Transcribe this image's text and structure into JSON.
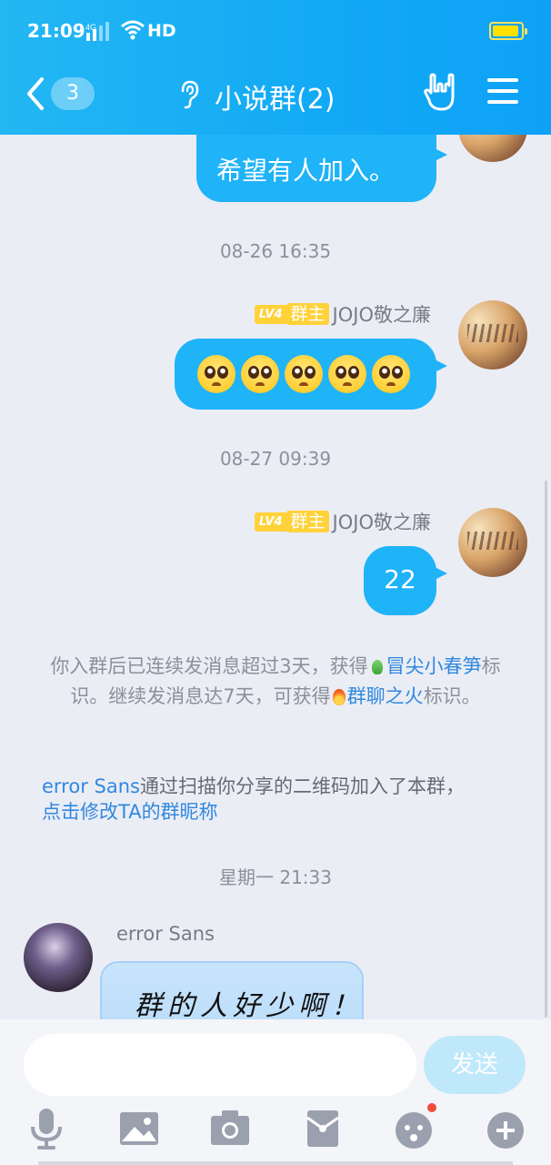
{
  "status_bar": {
    "time": "21:09",
    "network": "4G",
    "hd": "HD"
  },
  "header": {
    "back_count": "3",
    "title": "小说群(2)"
  },
  "messages": {
    "m1_text": "希望有人加入。",
    "ts1": "08-26 16:35",
    "m2_badge_level": "LV4",
    "m2_badge_role": "群主",
    "m2_sender": "JOJO敬之廉",
    "m2_emoji": "crying-pleading-emoji x5",
    "ts2": "08-27 09:39",
    "m3_badge_level": "LV4",
    "m3_badge_role": "群主",
    "m3_sender": "JOJO敬之廉",
    "m3_text": "22"
  },
  "notice": {
    "p1": "你入群后已连续发消息超过3天，获得",
    "link1": "冒尖小春笋",
    "p2": "标识。继续发消息达7天，可获得",
    "link2": "群聊之火",
    "p3": "标识。"
  },
  "join": {
    "user": "error Sans",
    "text": "通过扫描你分享的二维码加入了本群，",
    "link": "点击修改TA的群昵称"
  },
  "ts3": "星期一 21:33",
  "incoming": {
    "sender": "error Sans",
    "handwriting": "群的人好少啊！"
  },
  "composer": {
    "input_value": "",
    "send_label": "发送"
  },
  "toolbar_icons": [
    "microphone-icon",
    "image-icon",
    "camera-icon",
    "red-packet-icon",
    "emoji-icon",
    "plus-icon"
  ],
  "colors": {
    "header": "#12a9f5",
    "bubble_out": "#1fb3f8",
    "link": "#2f88e0",
    "badge": "#ffd23a"
  }
}
